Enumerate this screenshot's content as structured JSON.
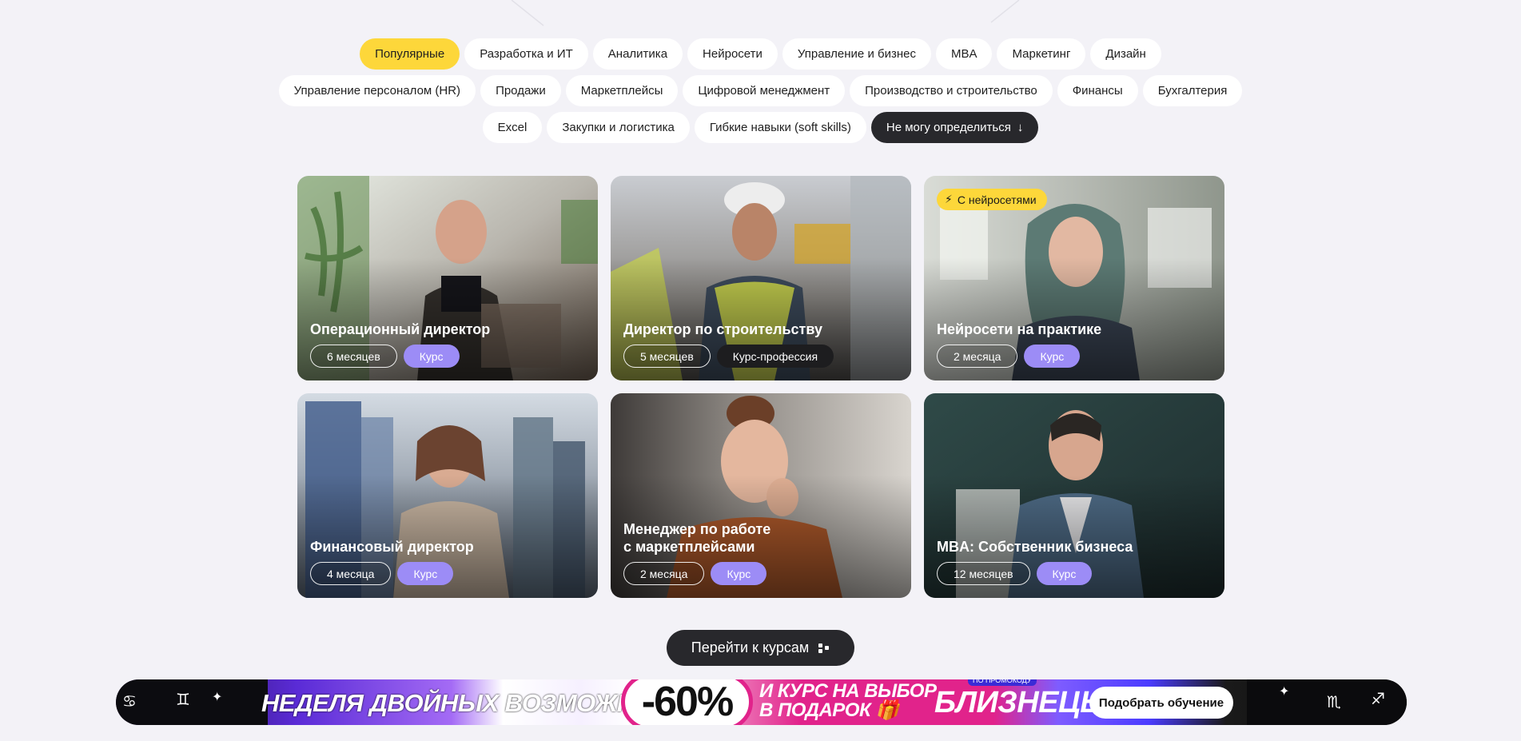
{
  "filters": {
    "row1": [
      "Популярные",
      "Разработка и ИТ",
      "Аналитика",
      "Нейросети",
      "Управление и бизнес",
      "MBA",
      "Маркетинг",
      "Дизайн"
    ],
    "row2": [
      "Управление персоналом (HR)",
      "Продажи",
      "Маркетплейсы",
      "Цифровой менеджмент",
      "Производство и строительство",
      "Финансы",
      "Бухгалтерия"
    ],
    "row3": [
      "Excel",
      "Закупки и логистика",
      "Гибкие навыки (soft skills)"
    ],
    "undecided": "Не могу определиться",
    "active": "Популярные"
  },
  "cards": [
    {
      "title": "Операционный директор",
      "duration": "6 месяцев",
      "type": "Курс",
      "type_style": "purple"
    },
    {
      "title": "Директор по строительству",
      "duration": "5 месяцев",
      "type": "Курс-профессия",
      "type_style": "black"
    },
    {
      "title": "Нейросети на практике",
      "duration": "2 месяца",
      "type": "Курс",
      "type_style": "purple",
      "badge": "С нейросетями"
    },
    {
      "title": "Финансовый директор",
      "duration": "4 месяца",
      "type": "Курс",
      "type_style": "purple"
    },
    {
      "title": "Менеджер по работе\nс маркетплейсами",
      "duration": "2 месяца",
      "type": "Курс",
      "type_style": "purple"
    },
    {
      "title": "MBA: Собственник бизнеса",
      "duration": "12 месяцев",
      "type": "Курс",
      "type_style": "purple"
    }
  ],
  "go_button": "Перейти к курсам",
  "banner": {
    "headline": "НЕДЕЛЯ ДВОЙНЫХ ВОЗМОЖНОСТЕЙ!",
    "discount": "-60%",
    "gift_line1": "И КУРС НА ВЫБОР",
    "gift_line2": "В ПОДАРОК",
    "promo_note": "ПО ПРОМОКОДУ",
    "promo_code": "БЛИЗНЕЦЫ",
    "cta": "Подобрать обучение"
  },
  "colors": {
    "accent_yellow": "#fdd73a",
    "dark": "#28282c",
    "purple_tag": "#9c8cf6",
    "page_bg": "#f3f2f7"
  }
}
